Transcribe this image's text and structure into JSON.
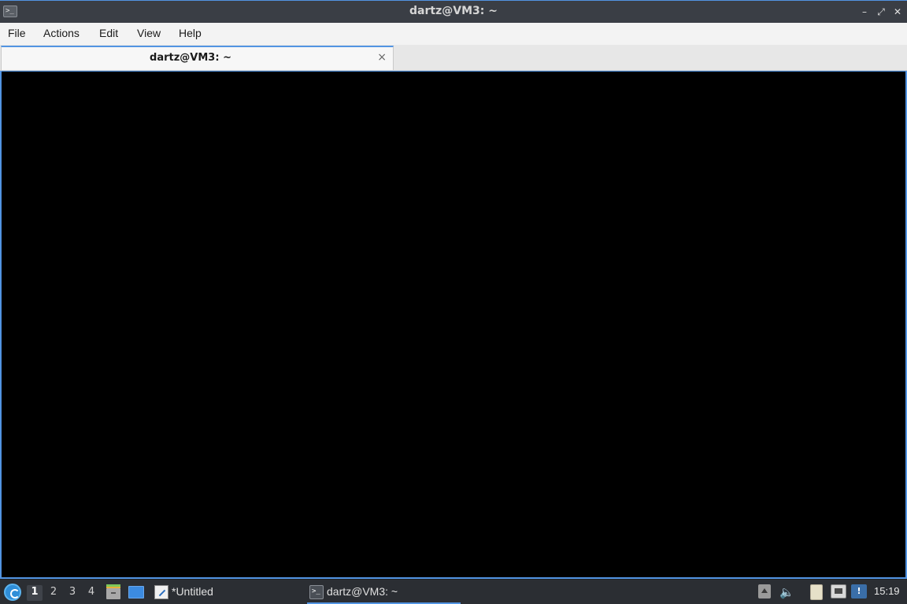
{
  "window": {
    "title": "dartz@VM3: ~",
    "controls": [
      "minimize-icon",
      "maximize-icon",
      "close-icon"
    ]
  },
  "menubar": {
    "items": [
      {
        "label": "File"
      },
      {
        "label": "Actions"
      },
      {
        "label": "Edit"
      },
      {
        "label": "View"
      },
      {
        "label": "Help"
      }
    ]
  },
  "tabs": [
    {
      "label": "dartz@VM3: ~",
      "active": true,
      "close_glyph": "×"
    }
  ],
  "terminal": {
    "background": "#000000",
    "content": ""
  },
  "taskbar": {
    "workspaces": [
      "1",
      "2",
      "3",
      "4"
    ],
    "active_workspace": "1",
    "quicklaunch": [
      "file-manager-icon",
      "show-desktop-icon"
    ],
    "tasks": [
      {
        "label": "*Untitled",
        "icon": "text-editor-icon",
        "active": false
      },
      {
        "label": "dartz@VM3: ~",
        "icon": "terminal-icon",
        "active": true
      }
    ],
    "tray": [
      "tray-expand-icon",
      "volume-icon",
      "clipboard-icon",
      "network-icon",
      "notification-icon"
    ],
    "clock": "15:19"
  },
  "colors": {
    "accent": "#5294e2",
    "titlebar": "#3a3e45",
    "taskbar": "#2b2e33",
    "menubar": "#f3f3f3"
  }
}
